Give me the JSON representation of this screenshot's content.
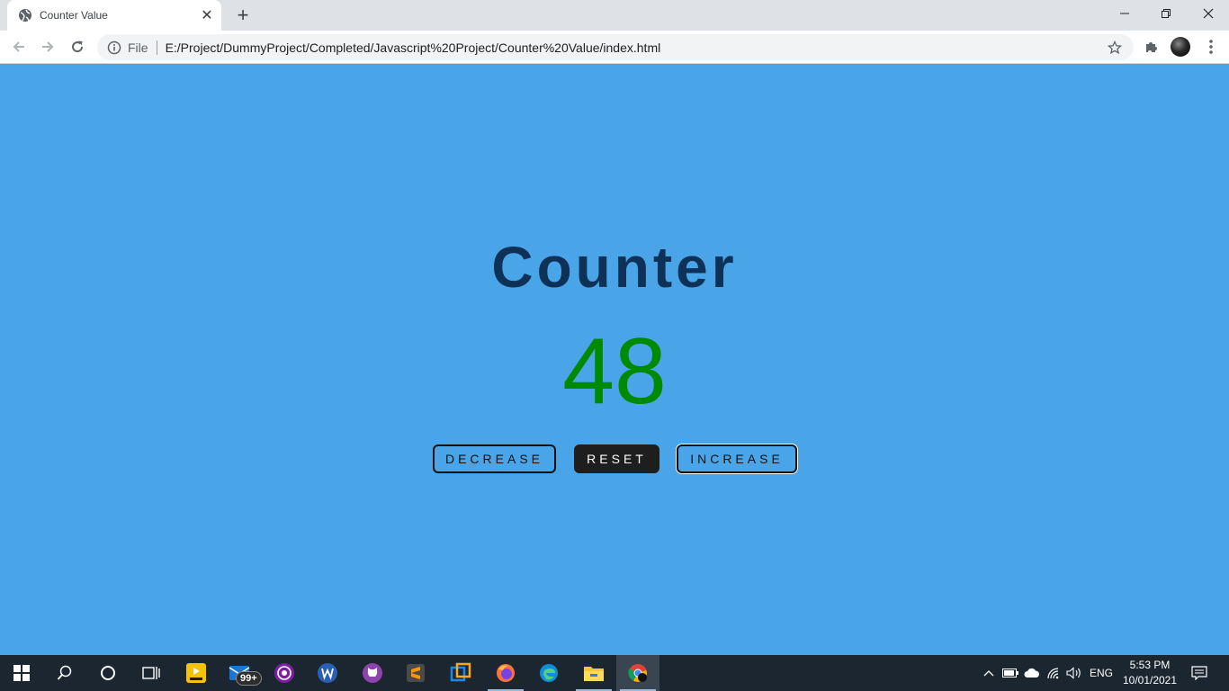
{
  "browser": {
    "tab": {
      "title": "Counter Value",
      "close_glyph": "✕"
    },
    "new_tab_glyph": "+",
    "window_controls": {
      "minimize": "—",
      "restore": "❐",
      "close": "✕"
    },
    "address": {
      "scheme_label": "File",
      "url": "E:/Project/DummyProject/Completed/Javascript%20Project/Counter%20Value/index.html"
    }
  },
  "page": {
    "title": "Counter",
    "counter_value": "48",
    "buttons": {
      "decrease": "DECREASE",
      "reset": "RESET",
      "increase": "INCREASE"
    },
    "colors": {
      "background": "#4aa5e8",
      "title": "#0d3157",
      "counter": "#008a00",
      "reset_bg": "#1e1e1e"
    }
  },
  "taskbar": {
    "apps": [
      {
        "name": "start-icon"
      },
      {
        "name": "search-icon"
      },
      {
        "name": "cortana-icon"
      },
      {
        "name": "task-view-icon"
      },
      {
        "name": "player-app-icon"
      },
      {
        "name": "mail-app-icon"
      },
      {
        "name": "podcast-app-icon"
      },
      {
        "name": "wps-app-icon"
      },
      {
        "name": "github-desktop-icon"
      },
      {
        "name": "sublime-text-icon"
      },
      {
        "name": "vmware-icon"
      },
      {
        "name": "firefox-icon"
      },
      {
        "name": "edge-icon"
      },
      {
        "name": "file-explorer-icon"
      },
      {
        "name": "chrome-icon"
      }
    ],
    "mail_badge": "99+",
    "language": "ENG",
    "time": "5:53 PM",
    "date": "10/01/2021"
  }
}
